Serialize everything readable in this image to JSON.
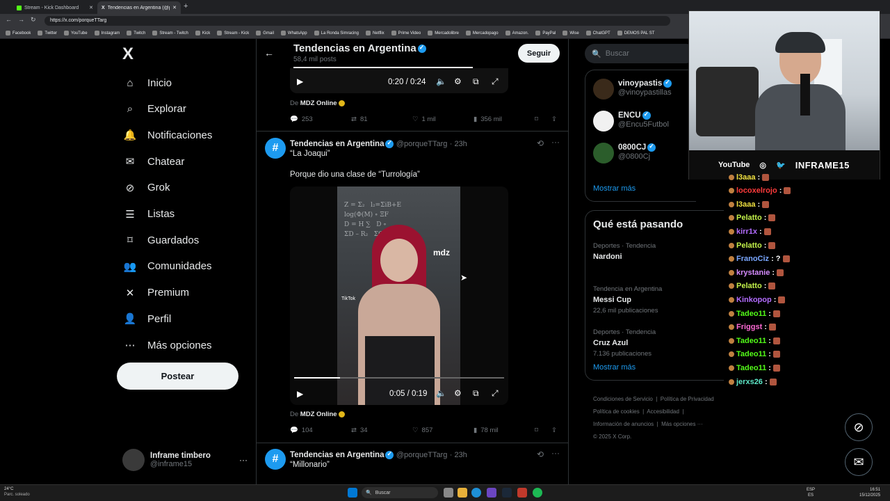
{
  "browser": {
    "tabs": [
      {
        "label": "Stream - Kick Dashboard",
        "active": false
      },
      {
        "label": "Tendencias en Argentina (@porqu",
        "active": true
      }
    ],
    "new_tab": "+",
    "url": "https://x.com/porqueTTarg",
    "bookmarks": [
      "Facebook",
      "Twitter",
      "YouTube",
      "Instagram",
      "Twitch",
      "Stream - Twitch",
      "Kick",
      "Stream - Kick",
      "Gmail",
      "WhatsApp",
      "La Ronda Simracing",
      "Netflix",
      "Prime Video",
      "Mercadolibre",
      "Mercadopago",
      "Amazon.",
      "PayPal",
      "Wise",
      "ChatGPT",
      "DEMOS PAL ST"
    ]
  },
  "nav": {
    "logo": "X",
    "items": [
      {
        "label": "Inicio",
        "icon": "home-icon"
      },
      {
        "label": "Explorar",
        "icon": "search-icon"
      },
      {
        "label": "Notificaciones",
        "icon": "bell-icon"
      },
      {
        "label": "Chatear",
        "icon": "mail-icon"
      },
      {
        "label": "Grok",
        "icon": "grok-icon"
      },
      {
        "label": "Listas",
        "icon": "list-icon"
      },
      {
        "label": "Guardados",
        "icon": "bookmark-icon"
      },
      {
        "label": "Comunidades",
        "icon": "people-icon"
      },
      {
        "label": "Premium",
        "icon": "x-icon"
      },
      {
        "label": "Perfil",
        "icon": "person-icon"
      },
      {
        "label": "Más opciones",
        "icon": "more-circle-icon"
      }
    ],
    "post_button": "Postear",
    "account": {
      "name": "Inframe timbero",
      "handle": "@inframe15",
      "more": "···"
    }
  },
  "header": {
    "title": "Tendencias en Argentina",
    "subtitle": "58,4 mil posts",
    "follow": "Seguir"
  },
  "tweets": [
    {
      "video_time": "0:20 / 0:24",
      "progress": 0.85,
      "source_prefix": "De",
      "source": "MDZ Online",
      "replies": "253",
      "reposts": "81",
      "likes": "1 mil",
      "views": "356 mil"
    },
    {
      "name": "Tendencias en Argentina",
      "handle": "@porqueTTarg",
      "time": "· 23h",
      "line1": "“La Joaqui”",
      "line2": "Porque dio una clase de “Turrología”",
      "video_time": "0:05 / 0:19",
      "progress": 0.22,
      "watermark": "mdz",
      "tiktok": "TikTok",
      "source_prefix": "De",
      "source": "MDZ Online",
      "replies": "104",
      "reposts": "34",
      "likes": "857",
      "views": "78 mil"
    },
    {
      "name": "Tendencias en Argentina",
      "handle": "@porqueTTarg",
      "time": "· 23h",
      "line1": "“Millonario”"
    }
  ],
  "right": {
    "search_placeholder": "Buscar",
    "who_to_follow": [
      {
        "name": "vinoypastis",
        "handle": "@vinoypastillas"
      },
      {
        "name": "ENCU",
        "handle": "@Encu5Futbol"
      },
      {
        "name": "0800CJ",
        "handle": "@0800Cj"
      }
    ],
    "show_more": "Mostrar más",
    "trends_title": "Qué está pasando",
    "trends": [
      {
        "category": "Deportes · Tendencia",
        "name": "Nardoni",
        "count": ""
      },
      {
        "category": "Tendencia en Argentina",
        "name": "Messi Cup",
        "count": "22,6 mil publicaciones"
      },
      {
        "category": "Deportes · Tendencia",
        "name": "Cruz Azul",
        "count": "7.136 publicaciones"
      }
    ],
    "trends_more": "Mostrar más",
    "footer": [
      "Condiciones de Servicio",
      "Política de Privacidad",
      "Política de cookies",
      "Accesibilidad",
      "Información de anuncios",
      "Más opciones ···",
      "© 2025 X Corp."
    ]
  },
  "overlay": {
    "socials": [
      "YouTube",
      "INFRAME15"
    ]
  },
  "chat": [
    {
      "user": "l3aaa",
      "msg": ":",
      "color": "#f0e040"
    },
    {
      "user": "locoxelrojo",
      "msg": ":",
      "color": "#ff3b3b"
    },
    {
      "user": "l3aaa",
      "msg": ":",
      "color": "#f0e040"
    },
    {
      "user": "Pelatto",
      "msg": ":",
      "color": "#c2f04a"
    },
    {
      "user": "kirr1x",
      "msg": ":",
      "color": "#b36cff"
    },
    {
      "user": "Pelatto",
      "msg": ":",
      "color": "#c2f04a"
    },
    {
      "user": "FranoCiz",
      "msg": ": ?",
      "color": "#7aa7ff"
    },
    {
      "user": "krystanie",
      "msg": ":",
      "color": "#d58bff"
    },
    {
      "user": "Pelatto",
      "msg": ":",
      "color": "#c2f04a"
    },
    {
      "user": "Kinkopop",
      "msg": ":",
      "color": "#b36cff"
    },
    {
      "user": "Tadeo11",
      "msg": ":",
      "color": "#53fc18"
    },
    {
      "user": "Friggst",
      "msg": ":",
      "color": "#ff6ad5"
    },
    {
      "user": "Tadeo11",
      "msg": ":",
      "color": "#53fc18"
    },
    {
      "user": "Tadeo11",
      "msg": ":",
      "color": "#53fc18"
    },
    {
      "user": "Tadeo11",
      "msg": ":",
      "color": "#53fc18"
    },
    {
      "user": "jerxs26",
      "msg": ":",
      "color": "#5ee8c8"
    }
  ],
  "taskbar": {
    "weather_temp": "24°C",
    "weather_desc": "Parc. soleado",
    "search": "Buscar",
    "lang": "ESP",
    "lang2": "ES",
    "time": "16:51",
    "date": "15/12/2025"
  }
}
